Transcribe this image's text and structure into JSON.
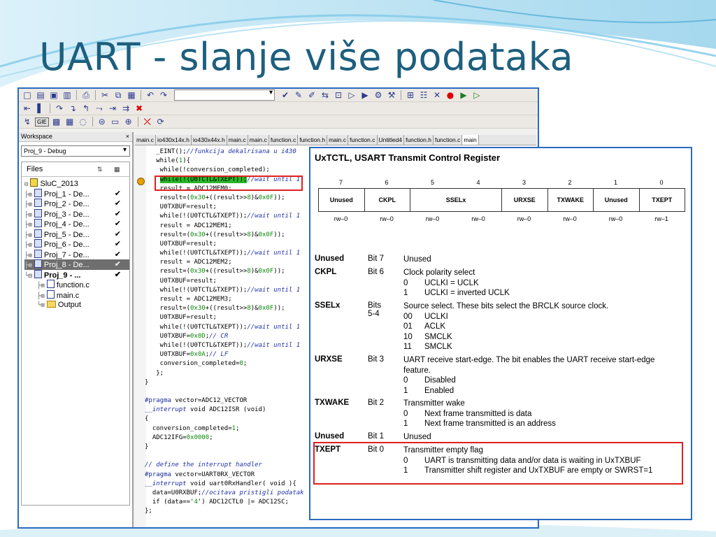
{
  "slide": {
    "title": "UART - slanje više podataka"
  },
  "ide": {
    "toolbar_icons": [
      "new-file",
      "open",
      "save",
      "save-all",
      "print",
      "cut",
      "copy",
      "paste",
      "undo",
      "redo"
    ],
    "workspace": {
      "header": "Workspace",
      "close": "×",
      "project_select": "Proj_9 - Debug",
      "files_label": "Files",
      "tree": [
        {
          "label": "SluC_2013",
          "check": ""
        },
        {
          "label": "Proj_1 - De...",
          "check": "✔"
        },
        {
          "label": "Proj_2 - De...",
          "check": "✔"
        },
        {
          "label": "Proj_3 - De...",
          "check": "✔"
        },
        {
          "label": "Proj_4 - De...",
          "check": "✔"
        },
        {
          "label": "Proj_5 - De...",
          "check": "✔"
        },
        {
          "label": "Proj_6 - De...",
          "check": "✔"
        },
        {
          "label": "Proj_7 - De...",
          "check": "✔"
        },
        {
          "label": "Proj_8 - De...",
          "check": "✔"
        },
        {
          "label": "Proj_9 - ...",
          "check": "✔"
        },
        {
          "label": "function.c",
          "check": ""
        },
        {
          "label": "main.c",
          "check": ""
        },
        {
          "label": "Output",
          "check": ""
        }
      ]
    },
    "tabs": [
      "main.c",
      "io430x14x.h",
      "io430x44x.h",
      "main.c",
      "main.c",
      "function.c",
      "function.h",
      "main.c",
      "function.c",
      "Untitled4",
      "function.h",
      "function.c",
      "main"
    ],
    "code": [
      "   _EINT();//funkcija dekalrisana u i430",
      "   while(1){",
      "    while(!conversion_completed);",
      "    while(!(U0TCTL&TXEPT));//wait until 1",
      "    result = ADC12MEM0;",
      "    result=(0x30+((result>>8)&0x0F));",
      "    U0TXBUF=result;",
      "    while(!(U0TCTL&TXEPT));//wait until 1",
      "    result = ADC12MEM1;",
      "    result=(0x30+((result>>8)&0x0F));",
      "    U0TXBUF=result;",
      "    while(!(U0TCTL&TXEPT));//wait until 1",
      "    result = ADC12MEM2;",
      "    result=(0x30+((result>>8)&0x0F));",
      "    U0TXBUF=result;",
      "    while(!(U0TCTL&TXEPT));//wait until 1",
      "    result = ADC12MEM3;",
      "    result=(0x30+((result>>8)&0x0F));",
      "    U0TXBUF=result;",
      "    while(!(U0TCTL&TXEPT));//wait until 1",
      "    U0TXBUF=0x0D;// CR",
      "    while(!(U0TCTL&TXEPT));//wait until 1",
      "    U0TXBUF=0x0A;// LF",
      "    conversion_completed=0;",
      "   };",
      "}",
      "",
      "#pragma vector=ADC12_VECTOR",
      "__interrupt void ADC12ISR (void)",
      "{",
      "  conversion_completed=1;",
      "  ADC12IFG=0x0000;",
      "}",
      "",
      "// define the interrupt handler",
      "#pragma vector=UART0RX_VECTOR",
      "__interrupt void uart0RxHandler( void ){",
      "  data=U0RXBUF;//ocitava pristigli podatak",
      "  if (data=='4') ADC12CTL0 |= ADC12SC;              // Start conversion",
      "};"
    ]
  },
  "register": {
    "title": "UxTCTL, USART Transmit Control Register",
    "bit_numbers": [
      "7",
      "6",
      "5",
      "4",
      "3",
      "2",
      "1",
      "0"
    ],
    "fields": [
      {
        "name": "Unused",
        "span": 1
      },
      {
        "name": "CKPL",
        "span": 1
      },
      {
        "name": "SSELx",
        "span": 2
      },
      {
        "name": "URXSE",
        "span": 1
      },
      {
        "name": "TXWAKE",
        "span": 1
      },
      {
        "name": "Unused",
        "span": 1
      },
      {
        "name": "TXEPT",
        "span": 1
      }
    ],
    "access": [
      "rw–0",
      "rw–0",
      "rw–0",
      "rw–0",
      "rw–0",
      "rw–0",
      "rw–0",
      "rw–1"
    ],
    "descriptions": [
      {
        "name": "Unused",
        "bits": "Bit 7",
        "text": "Unused",
        "options": []
      },
      {
        "name": "CKPL",
        "bits": "Bit 6",
        "text": "Clock polarity select",
        "options": [
          [
            "0",
            "UCLKI = UCLK"
          ],
          [
            "1",
            "UCLKI = inverted UCLK"
          ]
        ]
      },
      {
        "name": "SSELx",
        "bits": "Bits\n5-4",
        "text": "Source select. These bits select the BRCLK source clock.",
        "options": [
          [
            "00",
            "UCLKI"
          ],
          [
            "01",
            "ACLK"
          ],
          [
            "10",
            "SMCLK"
          ],
          [
            "11",
            "SMCLK"
          ]
        ]
      },
      {
        "name": "URXSE",
        "bits": "Bit 3",
        "text": "UART receive start-edge. The bit enables the UART receive start-edge feature.",
        "options": [
          [
            "0",
            "Disabled"
          ],
          [
            "1",
            "Enabled"
          ]
        ]
      },
      {
        "name": "TXWAKE",
        "bits": "Bit 2",
        "text": "Transmitter wake",
        "options": [
          [
            "0",
            "Next frame transmitted is data"
          ],
          [
            "1",
            "Next frame transmitted is an address"
          ]
        ]
      },
      {
        "name": "Unused",
        "bits": "Bit 1",
        "text": "Unused",
        "options": []
      },
      {
        "name": "TXEPT",
        "bits": "Bit 0",
        "text": "Transmitter empty flag",
        "options": [
          [
            "0",
            "UART is transmitting data and/or data is waiting in UxTXBUF"
          ],
          [
            "1",
            "Transmitter shift register and UxTXBUF are empty or SWRST=1"
          ]
        ]
      }
    ]
  },
  "colors": {
    "title": "#1d5f7e",
    "frame_blue": "#2a6cc0",
    "highlight_red": "#e02020",
    "code_highlight": "#28b828"
  }
}
